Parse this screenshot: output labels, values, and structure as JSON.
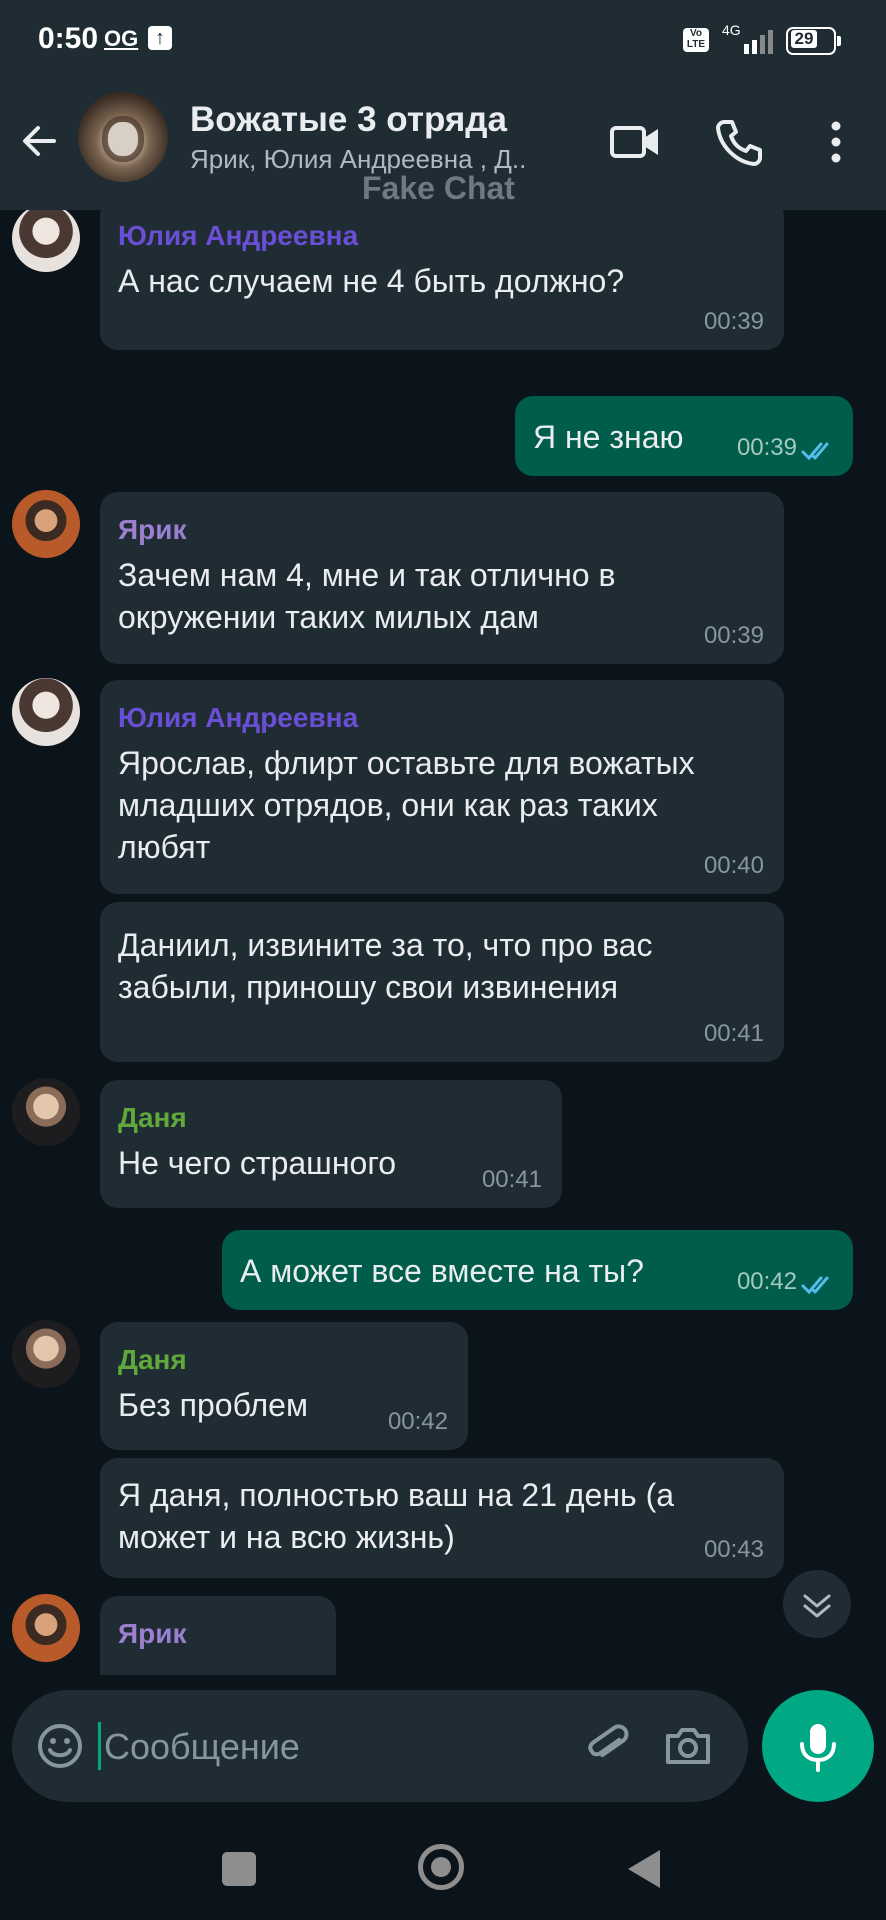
{
  "status_bar": {
    "time": "0:50",
    "carrier_badge": "OG",
    "network": "4G",
    "volte": "Vo LTE",
    "battery": "29"
  },
  "header": {
    "title": "Вожатые 3 отряда",
    "subtitle": "Ярик, Юлия Андреевна , Д..",
    "watermark": "Fake Chat",
    "icons": [
      "back-arrow-icon",
      "video-camera-icon",
      "phone-icon",
      "more-vert-icon"
    ]
  },
  "messages": [
    {
      "sender": "Юлия Андреевна",
      "sender_color": "#6a4fd6",
      "text": "А нас случаем не 4 быть должно?",
      "time": "00:39",
      "outgoing": false
    },
    {
      "sender": "",
      "text": "Я не знаю",
      "time": "00:39",
      "outgoing": true
    },
    {
      "sender": "Ярик",
      "sender_color": "#9b7fd0",
      "text": "Зачем нам 4, мне и так отлично в окружении таких милых дам",
      "time": "00:39",
      "outgoing": false
    },
    {
      "sender": "Юлия Андреевна",
      "sender_color": "#6a4fd6",
      "text": "Ярослав, флирт оставьте для вожатых младших отрядов, они как раз таких любят",
      "time": "00:40",
      "outgoing": false
    },
    {
      "sender": "",
      "text": "Даниил, извините за то, что про вас забыли, приношу свои извинения",
      "time": "00:41",
      "outgoing": false
    },
    {
      "sender": "Даня",
      "sender_color": "#5fa839",
      "text": "Не чего страшного",
      "time": "00:41",
      "outgoing": false
    },
    {
      "sender": "",
      "text": "А может все вместе на ты?",
      "time": "00:42",
      "outgoing": true
    },
    {
      "sender": "Даня",
      "sender_color": "#5fa839",
      "text": "Без проблем",
      "time": "00:42",
      "outgoing": false
    },
    {
      "sender": "",
      "text": "Я даня, полностью ваш на 21 день (а может и на всю жизнь)",
      "time": "00:43",
      "outgoing": false
    },
    {
      "sender": "Ярик",
      "sender_color": "#9b7fd0",
      "text": "",
      "time": "",
      "outgoing": false
    }
  ],
  "composer": {
    "placeholder": "Сообщение"
  }
}
